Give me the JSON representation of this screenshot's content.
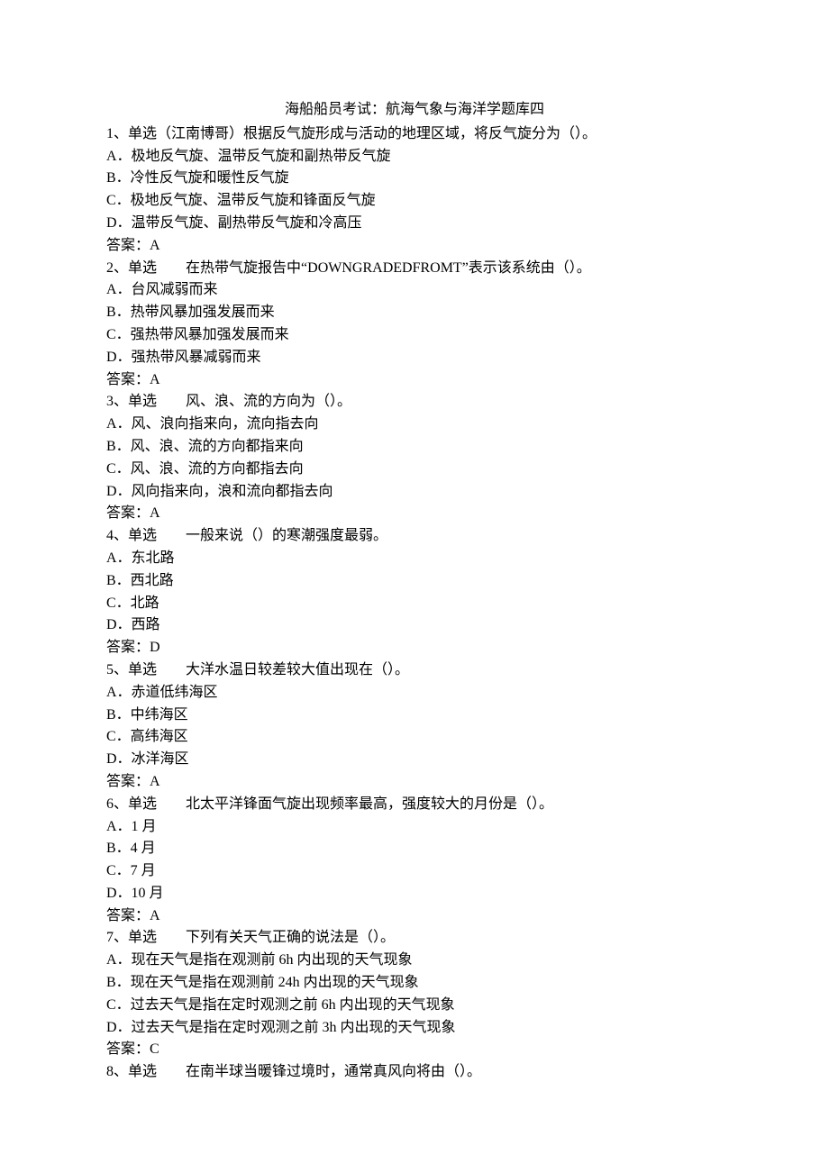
{
  "title": "海船船员考试：航海气象与海洋学题库四",
  "questions": [
    {
      "num": "1",
      "type": "单选",
      "source": "（江南博哥）",
      "stem": "根据反气旋形成与活动的地理区域，将反气旋分为（）。",
      "options": [
        "A．极地反气旋、温带反气旋和副热带反气旋",
        "B．冷性反气旋和暖性反气旋",
        "C．极地反气旋、温带反气旋和锋面反气旋",
        "D．温带反气旋、副热带反气旋和冷高压"
      ],
      "answer": "答案：A"
    },
    {
      "num": "2",
      "type": "单选",
      "source": "",
      "stem": "在热带气旋报告中“DOWNGRADEDFROMT”表示该系统由（）。",
      "options": [
        "A．台风减弱而来",
        "B．热带风暴加强发展而来",
        "C．强热带风暴加强发展而来",
        "D．强热带风暴减弱而来"
      ],
      "answer": "答案：A"
    },
    {
      "num": "3",
      "type": "单选",
      "source": "",
      "stem": "风、浪、流的方向为（）。",
      "options": [
        "A．风、浪向指来向，流向指去向",
        "B．风、浪、流的方向都指来向",
        "C．风、浪、流的方向都指去向",
        "D．风向指来向，浪和流向都指去向"
      ],
      "answer": "答案：A"
    },
    {
      "num": "4",
      "type": "单选",
      "source": "",
      "stem": "一般来说（）的寒潮强度最弱。",
      "options": [
        "A．东北路",
        "B．西北路",
        "C．北路",
        "D．西路"
      ],
      "answer": "答案：D"
    },
    {
      "num": "5",
      "type": "单选",
      "source": "",
      "stem": "大洋水温日较差较大值出现在（）。",
      "options": [
        "A．赤道低纬海区",
        "B．中纬海区",
        "C．高纬海区",
        "D．冰洋海区"
      ],
      "answer": "答案：A"
    },
    {
      "num": "6",
      "type": "单选",
      "source": "",
      "stem": "北太平洋锋面气旋出现频率最高，强度较大的月份是（）。",
      "options": [
        "A．1 月",
        "B．4 月",
        "C．7 月",
        "D．10 月"
      ],
      "answer": "答案：A"
    },
    {
      "num": "7",
      "type": "单选",
      "source": "",
      "stem": "下列有关天气正确的说法是（）。",
      "options": [
        "A．现在天气是指在观测前 6h 内出现的天气现象",
        "B．现在天气是指在观测前 24h 内出现的天气现象",
        "C．过去天气是指在定时观测之前 6h 内出现的天气现象",
        "D．过去天气是指在定时观测之前 3h 内出现的天气现象"
      ],
      "answer": "答案：C"
    },
    {
      "num": "8",
      "type": "单选",
      "source": "",
      "stem": "在南半球当暖锋过境时，通常真风向将由（）。",
      "options": [],
      "answer": ""
    }
  ]
}
